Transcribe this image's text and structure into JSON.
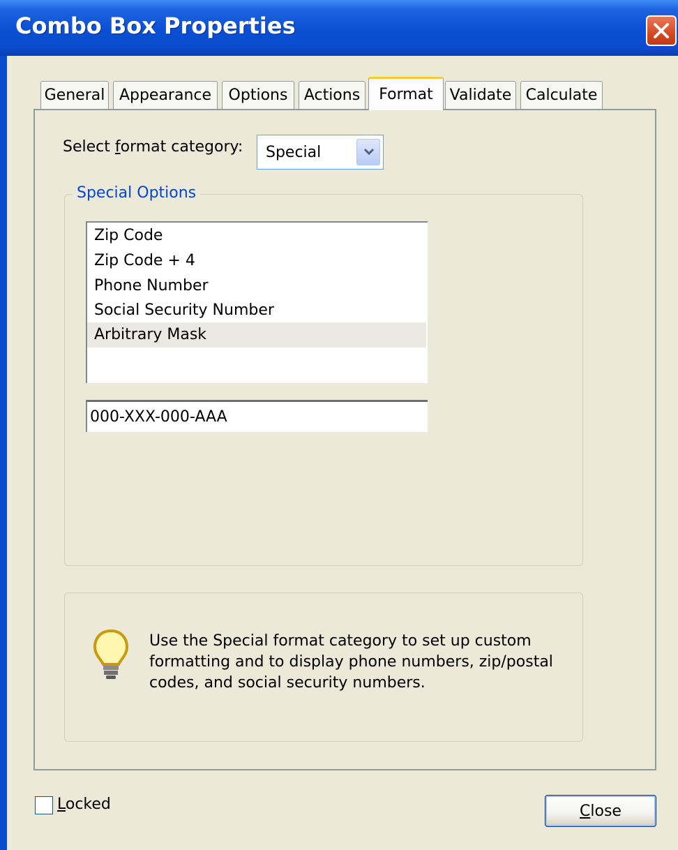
{
  "window": {
    "title": "Combo Box Properties"
  },
  "tabs": [
    {
      "label": "General"
    },
    {
      "label": "Appearance"
    },
    {
      "label": "Options"
    },
    {
      "label": "Actions"
    },
    {
      "label": "Format",
      "active": true
    },
    {
      "label": "Validate"
    },
    {
      "label": "Calculate"
    }
  ],
  "format": {
    "category_label_pre": "Select ",
    "category_label_key": "f",
    "category_label_post": "ormat category:",
    "category_value": "Special"
  },
  "special_options": {
    "legend": "Special Options",
    "items": [
      "Zip Code",
      "Zip Code + 4",
      "Phone Number",
      "Social Security Number",
      "Arbitrary Mask"
    ],
    "selected_index": 4,
    "mask_value": "000-XXX-000-AAA"
  },
  "tip": {
    "icon": "lightbulb-icon",
    "lines": [
      "Use the Special format category to set up custom",
      "formatting and to display phone numbers, zip/postal",
      "codes, and social security numbers."
    ]
  },
  "footer": {
    "locked_key": "L",
    "locked_rest": "ocked",
    "locked_checked": false,
    "close_key": "C",
    "close_rest": "lose"
  },
  "colors": {
    "titlebar": "#0a4fd3",
    "accent_tab": "#ffc83c",
    "group_label": "#0046d5",
    "face": "#ece9d8"
  }
}
